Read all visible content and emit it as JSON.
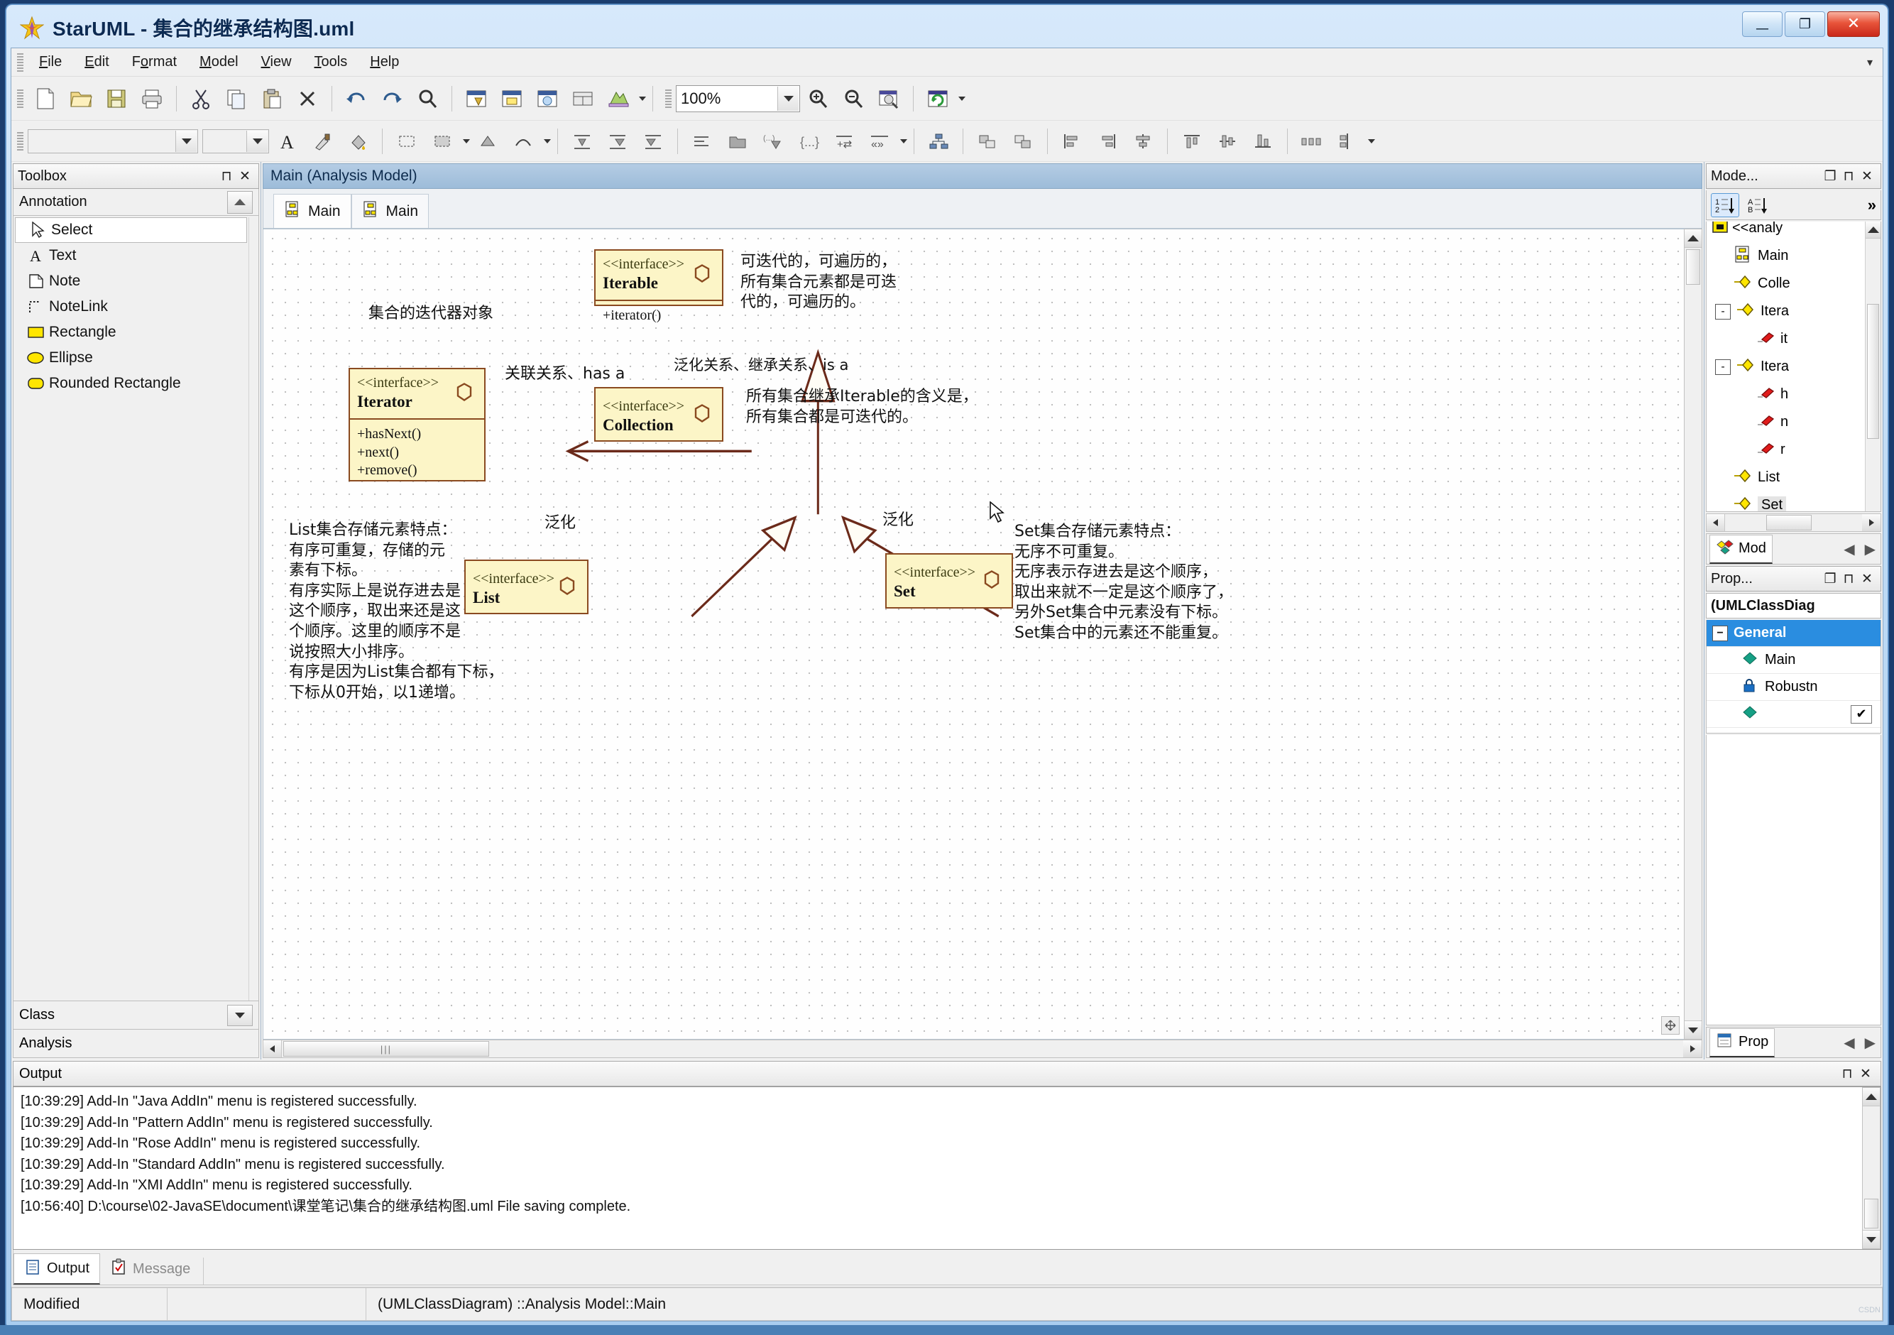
{
  "window": {
    "title": "StarUML - 集合的继承结构图.uml",
    "app_icon": "star-icon",
    "minimize": "—",
    "maximize": "❐",
    "close": "✕"
  },
  "menubar": {
    "items": [
      {
        "pre": "F",
        "u": "i",
        "post": "le"
      },
      {
        "pre": "",
        "u": "E",
        "post": "dit"
      },
      {
        "pre": "F",
        "u": "o",
        "post": "rmat"
      },
      {
        "pre": "",
        "u": "M",
        "post": "odel"
      },
      {
        "pre": "",
        "u": "V",
        "post": "iew"
      },
      {
        "pre": "",
        "u": "T",
        "post": "ools"
      },
      {
        "pre": "",
        "u": "H",
        "post": "elp"
      }
    ],
    "collapse": "▾"
  },
  "toolbar": {
    "zoom_value": "100%",
    "icons": [
      "new-file-icon",
      "open-folder-icon",
      "save-icon",
      "print-icon",
      "cut-icon",
      "copy-icon",
      "paste-icon",
      "delete-icon",
      "undo-icon",
      "redo-icon",
      "find-icon",
      "view-icon1",
      "view-icon2",
      "view-icon3",
      "layout-icon",
      "palette-icon"
    ],
    "zoom_icons": [
      "zoom-in-icon",
      "zoom-out-icon",
      "zoom-fit-icon",
      "refresh-icon"
    ]
  },
  "toolbar2": {
    "font_combo": "",
    "size_combo": "",
    "icons": [
      "font-icon",
      "format-brush-icon",
      "fill-color-icon",
      "shape-icon",
      "shape-fill-icon",
      "line-shape-icon",
      "line-style-icon",
      "align-icon1",
      "align-icon2",
      "align-icon3",
      "indent-icon",
      "folder-icon",
      "stereotype-icon",
      "braces-icon",
      "plus-tag-icon",
      "guillemets-icon",
      "hierarchy-icon",
      "copy-style-icon",
      "paste-style-icon",
      "align-left-icon",
      "align-right-icon",
      "align-center-icon",
      "dist-top-icon",
      "dist-mid-icon",
      "dist-bottom-icon",
      "space-h-icon",
      "space-v-icon"
    ]
  },
  "toolbox": {
    "title": "Toolbox",
    "pin": "⊓",
    "close": "✕",
    "group": "Annotation",
    "items": [
      {
        "label": "Select",
        "icon": "cursor-icon",
        "selected": true
      },
      {
        "label": "Text",
        "icon": "text-a-icon",
        "selected": false
      },
      {
        "label": "Note",
        "icon": "note-icon",
        "selected": false
      },
      {
        "label": "NoteLink",
        "icon": "notelink-icon",
        "selected": false
      },
      {
        "label": "Rectangle",
        "icon": "rectangle-icon",
        "selected": false
      },
      {
        "label": "Ellipse",
        "icon": "ellipse-icon",
        "selected": false
      },
      {
        "label": "Rounded Rectangle",
        "icon": "rounded-rectangle-icon",
        "selected": false
      }
    ],
    "group_class": "Class",
    "group_analysis": "Analysis"
  },
  "diagram": {
    "caption": "Main (Analysis Model)",
    "tabs": [
      {
        "label": "Main",
        "icon": "diagram-icon",
        "active": true
      },
      {
        "label": "Main",
        "icon": "diagram-icon",
        "active": false
      }
    ],
    "classes": [
      {
        "stereotype": "<<interface>>",
        "name": "Iterable",
        "ops": [
          "+iterator()"
        ]
      },
      {
        "stereotype": "<<interface>>",
        "name": "Iterator",
        "ops": [
          "+hasNext()",
          "+next()",
          "+remove()"
        ]
      },
      {
        "stereotype": "<<interface>>",
        "name": "Collection",
        "ops": []
      },
      {
        "stereotype": "<<interface>>",
        "name": "List",
        "ops": []
      },
      {
        "stereotype": "<<interface>>",
        "name": "Set",
        "ops": []
      }
    ],
    "labels": {
      "iterator_obj": "集合的迭代器对象",
      "iterable_note": "可迭代的，可遍历的，\n所有集合元素都是可迭\n代的，可遍历的。",
      "association": "关联关系、has a",
      "generalization_note": "泛化关系、继承关系、is a",
      "collection_note": "所有集合继承Iterable的含义是，\n所有集合都是可迭代的。",
      "gen_left": "泛化",
      "gen_right": "泛化",
      "list_note": "List集合存储元素特点：\n有序可重复，存储的元\n素有下标。\n有序实际上是说存进去是\n这个顺序，取出来还是这\n个顺序。这里的顺序不是\n说按照大小排序。\n有序是因为List集合都有下标，\n下标从0开始，以1递增。",
      "set_note": "Set集合存储元素特点：\n无序不可重复。\n无序表示存进去是这个顺序，\n取出来就不一定是这个顺序了，\n另外Set集合中元素没有下标。\nSet集合中的元素还不能重复。"
    }
  },
  "model_explorer": {
    "title": "Mode...",
    "maximize": "❐",
    "pin": "⊓",
    "close": "✕",
    "sort_numeric": "sort-numeric-icon",
    "sort_alpha": "sort-alpha-icon",
    "more": "»",
    "items": [
      {
        "label": "<<analy",
        "icon": "package-icon",
        "indent": 0,
        "expander": "",
        "cut": true
      },
      {
        "label": "Main",
        "icon": "diagram-icon",
        "indent": 1,
        "expander": ""
      },
      {
        "label": "Colle",
        "icon": "interface-icon",
        "indent": 1,
        "expander": ""
      },
      {
        "label": "Itera",
        "icon": "interface-icon",
        "indent": 1,
        "expander": "-"
      },
      {
        "label": "it",
        "icon": "operation-icon",
        "indent": 2,
        "expander": ""
      },
      {
        "label": "Itera",
        "icon": "interface-icon",
        "indent": 1,
        "expander": "-"
      },
      {
        "label": "h",
        "icon": "operation-icon",
        "indent": 2,
        "expander": ""
      },
      {
        "label": "n",
        "icon": "operation-icon",
        "indent": 2,
        "expander": ""
      },
      {
        "label": "r",
        "icon": "operation-icon",
        "indent": 2,
        "expander": ""
      },
      {
        "label": "List",
        "icon": "interface-icon",
        "indent": 1,
        "expander": ""
      },
      {
        "label": "Set",
        "icon": "interface-icon",
        "indent": 1,
        "expander": "",
        "selected": true
      }
    ],
    "tab_label": "Mod",
    "nav_prev": "◀",
    "nav_next": "▶"
  },
  "properties": {
    "title": "Prop...",
    "maximize": "❐",
    "pin": "⊓",
    "close": "✕",
    "target": "(UMLClassDiag",
    "group": "General",
    "rows": [
      {
        "icon": "diamond-icon",
        "label": "Main",
        "value": ""
      },
      {
        "icon": "lock-icon",
        "label": "Robustn",
        "value": ""
      },
      {
        "icon": "diamond-icon",
        "label": "",
        "value": "✔"
      }
    ],
    "tab_label": "Prop",
    "nav_prev": "◀",
    "nav_next": "▶"
  },
  "output": {
    "title": "Output",
    "pin": "⊓",
    "close": "✕",
    "lines": [
      "[10:39:29]  Add-In \"Java AddIn\" menu is registered successfully.",
      "[10:39:29]  Add-In \"Pattern AddIn\" menu is registered successfully.",
      "[10:39:29]  Add-In \"Rose AddIn\" menu is registered successfully.",
      "[10:39:29]  Add-In \"Standard AddIn\" menu is registered successfully.",
      "[10:39:29]  Add-In \"XMI AddIn\" menu is registered successfully.",
      "[10:56:40]  D:\\course\\02-JavaSE\\document\\课堂笔记\\集合的继承结构图.uml File saving complete."
    ],
    "tabs": [
      {
        "label": "Output",
        "icon": "output-icon",
        "active": true
      },
      {
        "label": "Message",
        "icon": "message-icon",
        "active": false
      }
    ]
  },
  "statusbar": {
    "state": "Modified",
    "middle": "",
    "selection": "(UMLClassDiagram) ::Analysis Model::Main"
  },
  "colors": {
    "uml_fill": "#fcf5c7",
    "uml_border": "#8a4a20",
    "titlebar_accent": "#0c2a52",
    "selection_blue": "#2a8de0"
  }
}
